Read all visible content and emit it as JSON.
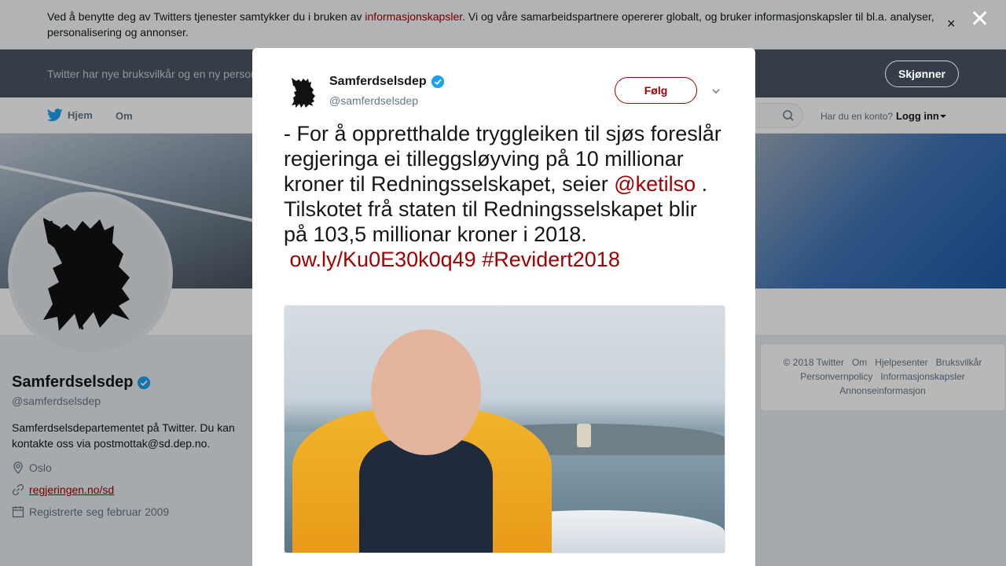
{
  "cookie": {
    "text_before": "Ved å benytte deg av Twitters tjenester samtykker du i bruken av ",
    "link": "informasjonskapsler",
    "text_after": ". Vi og våre samarbeidspartnere opererer globalt, og bruker informasjonskapsler til bl.a. analyser, personalisering og annonser.",
    "close": "×"
  },
  "terms": {
    "text": "Twitter har nye bruksvilkår og en ny personvernpolicy",
    "button": "Skjønner"
  },
  "nav": {
    "home": "Hjem",
    "about": "Om",
    "login_question": "Har du en konto?",
    "login": "Logg inn"
  },
  "profile": {
    "name": "Samferdselsdep",
    "handle": "@samferdselsdep",
    "bio": "Samferdselsdepartementet på Twitter. Du kan kontakte oss via postmottak@sd.dep.no.",
    "location": "Oslo",
    "website": "regjeringen.no/sd",
    "joined": "Registrerte seg februar 2009"
  },
  "footer": {
    "copyright": "© 2018 Twitter",
    "about": "Om",
    "help": "Hjelpesenter",
    "terms": "Bruksvilkår",
    "privacy": "Personvernpolicy",
    "cookies": "Informasjonskapsler",
    "ads": "Annonseinformasjon"
  },
  "modal": {
    "close": "✕",
    "name": "Samferdselsdep",
    "handle": "@samferdselsdep",
    "follow": "Følg",
    "text_line1": "- For å oppretthalde tryggleiken til sjøs foreslår regjeringa ei tilleggsløyving på 10 millionar kroner til Redningsselskapet, seier ",
    "mention": "@ketilso",
    "text_line1_end": " .",
    "text_line2": "Tilskotet frå staten til Redningsselskapet blir på 103,5 millionar kroner i 2018.",
    "link": "ow.ly/Ku0E30k0q49",
    "hashtag": "#Revidert2018"
  },
  "colors": {
    "accent": "#a10000",
    "verified": "#1da1f2",
    "twitter_blue": "#1da1f2"
  },
  "icons": [
    "twitter-bird-icon",
    "search-icon",
    "verified-icon",
    "location-icon",
    "link-icon",
    "calendar-icon",
    "chevron-down-icon",
    "close-icon"
  ]
}
